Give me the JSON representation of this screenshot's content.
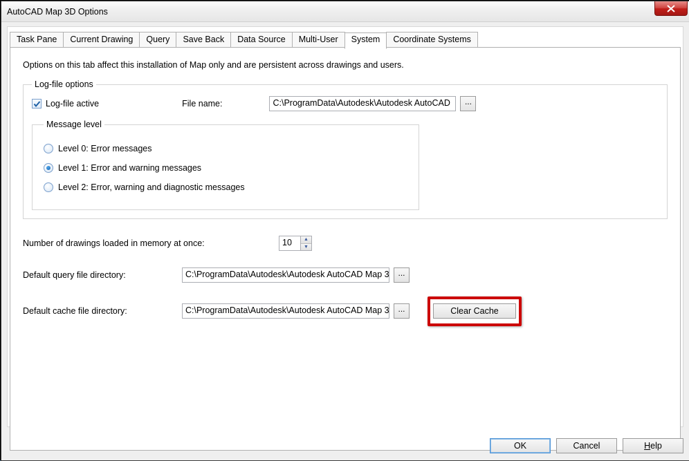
{
  "window": {
    "title": "AutoCAD Map 3D Options"
  },
  "tabs": [
    {
      "label": "Task Pane"
    },
    {
      "label": "Current Drawing"
    },
    {
      "label": "Query"
    },
    {
      "label": "Save Back"
    },
    {
      "label": "Data Source"
    },
    {
      "label": "Multi-User"
    },
    {
      "label": "System"
    },
    {
      "label": "Coordinate Systems"
    }
  ],
  "active_tab": "System",
  "system": {
    "description": "Options on this tab affect this installation of Map only and are persistent across drawings and users.",
    "logfile": {
      "legend": "Log-file options",
      "active_label": "Log-file active",
      "active_checked": true,
      "filename_label": "File name:",
      "filename_value": "C:\\ProgramData\\Autodesk\\Autodesk AutoCAD"
    },
    "message_level": {
      "legend": "Message level",
      "options": [
        {
          "label": "Level 0: Error messages"
        },
        {
          "label": "Level 1: Error and warning messages"
        },
        {
          "label": "Level 2: Error, warning and diagnostic messages"
        }
      ],
      "selected_index": 1
    },
    "drawings_loaded": {
      "label": "Number of drawings loaded in memory at once:",
      "value": "10"
    },
    "query_dir": {
      "label": "Default query file directory:",
      "value": "C:\\ProgramData\\Autodesk\\Autodesk AutoCAD Map 3"
    },
    "cache_dir": {
      "label": "Default cache file directory:",
      "value": "C:\\ProgramData\\Autodesk\\Autodesk AutoCAD Map 3",
      "clear_label": "Clear Cache"
    }
  },
  "footer": {
    "ok": "OK",
    "cancel": "Cancel",
    "help_u": "H",
    "help_rest": "elp"
  },
  "icons": {
    "browse": "..."
  }
}
